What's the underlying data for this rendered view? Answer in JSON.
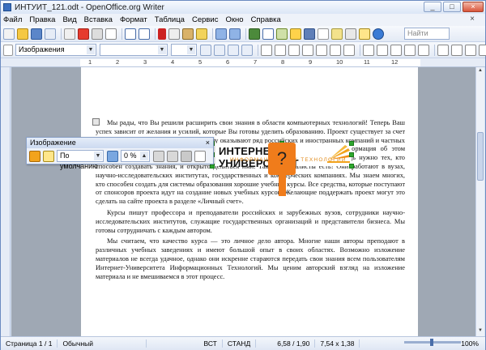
{
  "window": {
    "title": "ИНТУИТ_121.odt - OpenOffice.org Writer",
    "buttons": [
      "_",
      "□",
      "×"
    ]
  },
  "menu": [
    "Файл",
    "Правка",
    "Вид",
    "Вставка",
    "Формат",
    "Таблица",
    "Сервис",
    "Окно",
    "Справка"
  ],
  "toolbar2": {
    "style": "Изображения"
  },
  "search": {
    "placeholder": "Найти"
  },
  "ruler": [
    "1",
    "2",
    "3",
    "4",
    "5",
    "6",
    "7",
    "8",
    "9",
    "10",
    "11",
    "12"
  ],
  "float_toolbar": {
    "title": "Изображение",
    "filter": "По умолчанию",
    "percent": "0 %"
  },
  "callout": "?",
  "logo": {
    "main": "ИНТЕРНЕТ УНИВЕРСИТЕТ",
    "sub": "ИНФОРМАЦИОННЫХ ТЕХНОЛОГИЙ"
  },
  "document": {
    "paragraphs": [
      "Мы рады, что Вы решили расширить свои знания в области компьютерных технологий! Теперь Ваш успех зависит от желания и усилий, которые Вы готовы уделить образованию. Проект существует за счет учредителей. Финансовую поддержку ему оказывают ряд российских и иностранных компаний и частных лиц. Некоторые курсы создаются при поддержке компаний и частных лиц, информация об этом специально указывается на сайте. Мы считаем, что поддерживать в первую очередь нужно тех, кто способен создавать знания, и открыто делиться ими. Такие специалисты есть! Они работают в вузах, научно-исследовательских институтах, государственных и коммерческих компаниях. Мы знаем многих, кто способен создать для системы образования хорошие учебные курсы. Все средства, которые поступают от спонсоров проекта идут на создание новых учебных курсов. Желающие поддержать проект могут это сделать на сайте проекта в разделе «Личный счет».",
      "Курсы пишут профессора и преподаватели российских и зарубежных вузов, сотрудники научно-исследовательских институтов, служащие государственных организаций и представители бизнеса. Мы готовы сотрудничать с каждым автором.",
      "Мы считаем, что качество курса — это личное дело автора. Многие наши авторы преподают в различных учебных заведениях и имеют большой опыт в своих областях. Возможно изложение материалов не всегда удачное, однако они искренне стараются передать свои знания всем пользователям Интернет-Университета Информационных Технологий. Мы ценим авторский взгляд на изложение материала и не вмешиваемся в этот процесс."
    ]
  },
  "status": {
    "page": "Страница 1 / 1",
    "style": "Обычный",
    "lang": "",
    "insert": "ВСТ",
    "std": "СТАНД",
    "pos": "6,58 / 1,90",
    "size": "7,54 x 1,38",
    "zoom": "100%"
  }
}
